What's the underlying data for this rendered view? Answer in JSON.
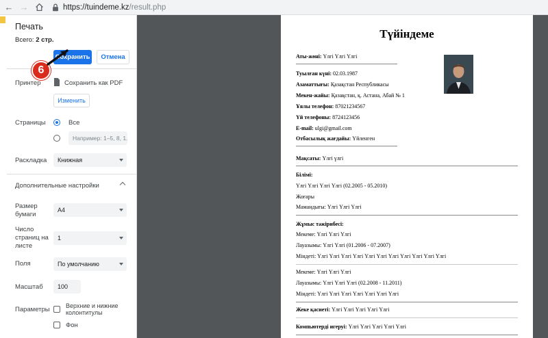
{
  "browser": {
    "url_host": "https://tuindeme.kz",
    "url_path": "/result.php"
  },
  "dialog": {
    "title": "Печать",
    "total_label": "Всего:",
    "total_value": "2 стр.",
    "save_label": "Сохранить",
    "cancel_label": "Отмена",
    "printer_label": "Принтер",
    "printer_value": "Сохранить как PDF",
    "change_label": "Изменить",
    "pages_label": "Страницы",
    "pages_all": "Все",
    "pages_placeholder": "Например: 1–5, 8, 1...",
    "layout_label": "Раскладка",
    "layout_value": "Книжная",
    "more_settings": "Дополнительные настройки",
    "paper_size_label": "Размер бумаги",
    "paper_size_value": "A4",
    "pages_per_sheet_label": "Число страниц на листе",
    "pages_per_sheet_value": "1",
    "margins_label": "Поля",
    "margins_value": "По умолчанию",
    "scale_label": "Масштаб",
    "scale_value": "100",
    "options_label": "Параметры",
    "option_headers": "Верхние и нижние колонтитулы",
    "option_background": "Фон"
  },
  "badge": {
    "step": "6"
  },
  "resume": {
    "title": "Түйіндеме",
    "fields": [
      {
        "label": "Аты-жөні:",
        "value": " Үлгі Үлгі Үлгі"
      },
      {
        "label": "Туылған күні:",
        "value": " 02.03.1987"
      },
      {
        "label": "Азаматтығы:",
        "value": " Қазақстан Республикасы"
      },
      {
        "label": "Мекен-жайы:",
        "value": " Қазақстан, қ. Астана, Абай № 1"
      },
      {
        "label": "Ұялы телефон:",
        "value": " 87021234567"
      },
      {
        "label": "Үй телефоны:",
        "value": " 8724123456"
      },
      {
        "label": "E-mail:",
        "value": " ulgi@gmail.com"
      },
      {
        "label": "Отбасылық жағдайы:",
        "value": " Үйленген"
      }
    ],
    "goal": {
      "label": "Мақсаты:",
      "value": " Үлгі үлгі"
    },
    "education": {
      "label": "Білімі:",
      "line1": "Үлгі Үлгі Үлгі Үлгі (02.2005 - 05.2010)",
      "line2": "Жоғары",
      "spec_label": "Мамандығы:",
      "spec_value": " Үлгі Үлгі Үлгі"
    },
    "experience": {
      "label": "Жұмыс тәжірибесі:",
      "jobs": [
        {
          "org": "Мекеме: Үлгі Үлгі Үлгі",
          "pos": "Лауазымы: Үлгі Үлгі (01.2006 - 07.2007)",
          "duty": "Міндеті: Үлгі Үлгі Үлгі Үлгі Үлгі Үлгі Үлгі Үлгі Үлгі Үлгі Үлгі"
        },
        {
          "org": "Мекеме: Үлгі Үлгі Үлгі",
          "pos": "Лауазымы: Үлгі Үлгі Үлгі (02.2008 - 11.2011)",
          "duty": "Міндеті: Үлгі Үлгі Үлгі Үлгі Үлгі Үлгі Үлгі"
        }
      ]
    },
    "personal": {
      "label": "Жеке қасиеті:",
      "value": " Үлгі Үлгі Үлгі Үлгі Үлгі"
    },
    "computer": {
      "label": "Компьютерді игеруі:",
      "value": " Үлгі Үлгі Үлгі Үлгі Үлгі"
    }
  }
}
